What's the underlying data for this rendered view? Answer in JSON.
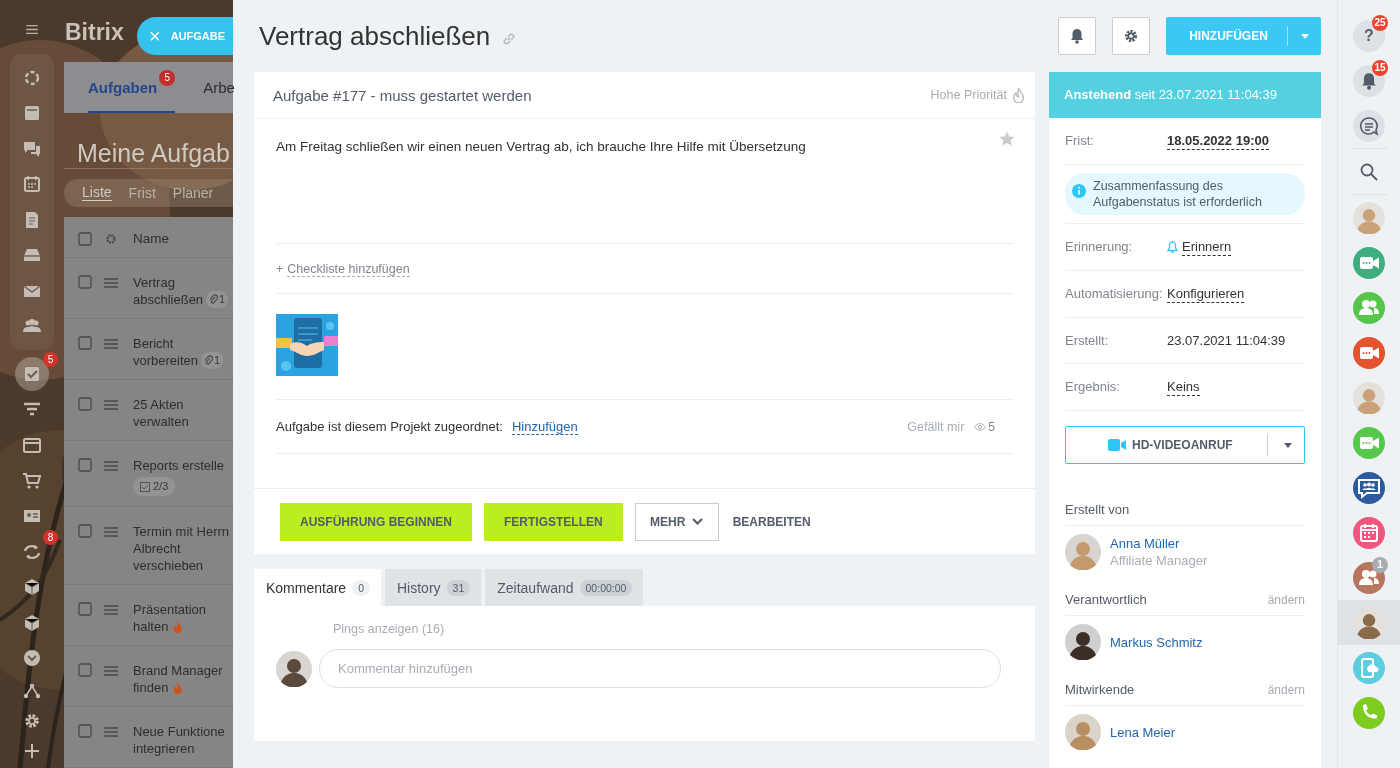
{
  "backdrop": {
    "brand": "Bitrix",
    "close_tab": {
      "icon": "×",
      "label": "AUFGABE"
    },
    "nav_items": [
      {
        "selected": false
      },
      {
        "selected": false
      },
      {
        "selected": false
      },
      {
        "selected": false
      },
      {
        "selected": false
      },
      {
        "selected": false
      },
      {
        "selected": false
      },
      {
        "selected": false
      },
      {
        "selected": true,
        "badge": "5"
      },
      {
        "selected": false
      },
      {
        "selected": false
      },
      {
        "selected": false
      },
      {
        "selected": false
      },
      {
        "selected": false,
        "badge": "8"
      },
      {
        "selected": false
      },
      {
        "selected": false
      },
      {
        "selected": false
      },
      {
        "selected": false
      },
      {
        "selected": false
      },
      {
        "selected": false
      }
    ],
    "tabs": [
      {
        "label": "Aufgaben",
        "badge": "5",
        "selected": true
      },
      {
        "label": "Arbe",
        "selected": false
      }
    ],
    "heading": "Meine Aufgab",
    "views": [
      {
        "label": "Liste",
        "selected": true
      },
      {
        "label": "Frist",
        "selected": false
      },
      {
        "label": "Planer",
        "selected": false
      }
    ],
    "list": {
      "column": "Name",
      "all_checked": false,
      "rows": [
        {
          "lines": [
            "Vertrag",
            "abschließen"
          ],
          "attachments": "1",
          "hot": false,
          "checked": false
        },
        {
          "lines": [
            "Bericht",
            "vorbereiten"
          ],
          "attachments": "1",
          "hot": false,
          "checked": false
        },
        {
          "lines": [
            "25 Akten",
            "verwalten"
          ],
          "hot": false,
          "checked": false
        },
        {
          "lines": [
            "Reports erstelle"
          ],
          "checklist": "2/3",
          "hot": false,
          "checked": false
        },
        {
          "lines": [
            "Termin mit Herrn",
            "Albrecht",
            "verschieben"
          ],
          "hot": false,
          "checked": false
        },
        {
          "lines": [
            "Präsentation",
            "halten"
          ],
          "hot": true,
          "checked": false
        },
        {
          "lines": [
            "Brand Manager",
            "finden"
          ],
          "hot": true,
          "checked": false
        },
        {
          "lines": [
            "Neue Funktione",
            "integrieren"
          ],
          "hot": false,
          "checked": false
        }
      ]
    }
  },
  "task": {
    "title": "Vertrag abschließen",
    "add_button": "HINZUFÜGEN",
    "card": {
      "status_line": "Aufgabe #177 - muss gestartet werden",
      "priority": "Hohe Priorität",
      "description": "Am Freitag schließen wir einen neuen Vertrag ab, ich brauche Ihre Hilfe mit Übersetzung",
      "starred": false,
      "checklist": {
        "prefix": "+",
        "label": "Checkliste hinzufügen"
      },
      "project": {
        "label": "Aufgabe ist diesem Projekt zugeordnet:",
        "link": "Hinzufügen"
      },
      "like": "Gefällt mir",
      "views": "5"
    },
    "actions": [
      {
        "kind": "primary",
        "label": "AUSFÜHRUNG BEGINNEN"
      },
      {
        "kind": "primary",
        "label": "FERTIGSTELLEN"
      },
      {
        "kind": "dropdown",
        "label": "MEHR"
      },
      {
        "kind": "link",
        "label": "BEARBEITEN"
      }
    ],
    "tabs": [
      {
        "label": "Kommentare",
        "count": "0",
        "selected": true
      },
      {
        "label": "History",
        "count": "31",
        "selected": false
      },
      {
        "label": "Zeitaufwand",
        "count": "00:00:00",
        "selected": false
      }
    ],
    "comments": {
      "pings": "Pings anzeigen (16)",
      "placeholder": "Kommentar hinzufügen"
    }
  },
  "sidebar": {
    "status": "**Anstehend** seit 23.07.2021 11:04:39",
    "fields": [
      {
        "kind": "deadline",
        "label": "Frist:",
        "value": "18.05.2022 19:00"
      },
      {
        "kind": "notice",
        "text": "Zusammenfassung des Aufgabenstatus ist erforderlich"
      },
      {
        "kind": "reminder",
        "label": "Erinnerung:",
        "value": "Erinnern"
      },
      {
        "kind": "action",
        "label": "Automatisierung:",
        "value": "Konfigurieren"
      },
      {
        "kind": "text",
        "label": "Erstellt:",
        "value": "23.07.2021 11:04:39"
      },
      {
        "kind": "action",
        "label": "Ergebnis:",
        "value": "Keins"
      }
    ],
    "video_call": "HD-VIDEOANRUF",
    "people": [
      {
        "role": "Erstellt von",
        "members": [
          {
            "name": "Anna Müller",
            "position": "Affiliate Manager"
          }
        ]
      },
      {
        "role": "Verantwortlich",
        "action": "ändern",
        "members": [
          {
            "name": "Markus Schmitz"
          }
        ]
      },
      {
        "role": "Mitwirkende",
        "action": "ändern",
        "members": [
          {
            "name": "Lena Meier"
          }
        ]
      }
    ]
  },
  "right_bar": {
    "items": [
      {
        "kind": "help",
        "icon": "?",
        "badge": "25",
        "selected": false
      },
      {
        "kind": "notifications",
        "badge": "15",
        "selected": false
      },
      {
        "kind": "chats",
        "selected": false
      },
      {
        "kind": "search",
        "selected": false
      },
      {
        "kind": "avatar",
        "selected": false
      },
      {
        "kind": "video",
        "color": "#3fae7e",
        "selected": false
      },
      {
        "kind": "group",
        "color": "#55c64a",
        "selected": false
      },
      {
        "kind": "video",
        "color": "#e5532e",
        "selected": false
      },
      {
        "kind": "avatar",
        "selected": false
      },
      {
        "kind": "video",
        "color": "#56c84c",
        "selected": false
      },
      {
        "kind": "groupchat",
        "color": "#2b5b9e",
        "selected": false
      },
      {
        "kind": "calendar",
        "color": "#f2567e",
        "selected": false
      },
      {
        "kind": "group",
        "color": "#b87560",
        "badge": "1",
        "selected": false
      },
      {
        "kind": "avatar",
        "selected": true
      },
      {
        "kind": "device",
        "color": "#5ecde0",
        "selected": false
      },
      {
        "kind": "phone",
        "color": "#7dcc1e",
        "selected": false
      }
    ]
  }
}
